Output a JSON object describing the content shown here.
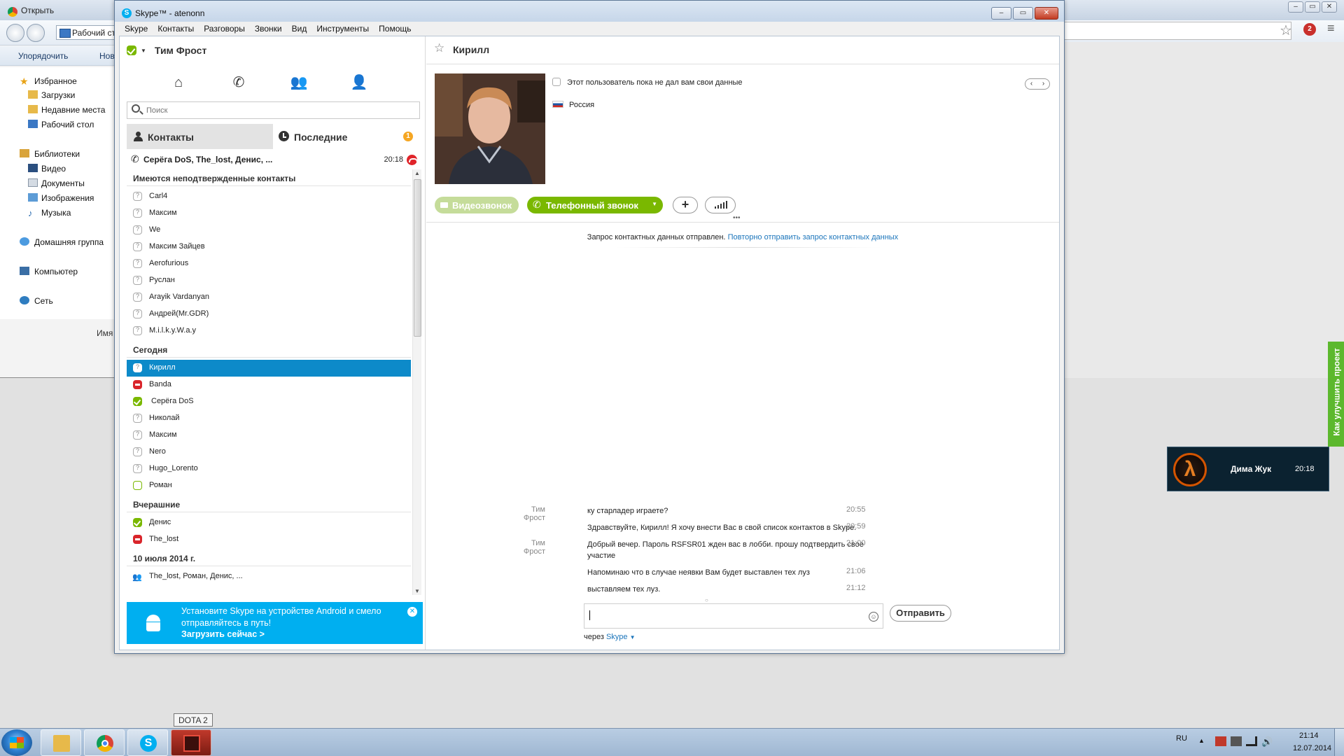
{
  "bg_window": {
    "title": "Открыть",
    "address": "Рабочий стол",
    "organize": "Упорядочить",
    "new_folder": "Нов",
    "nav": {
      "favorites": "Избранное",
      "downloads": "Загрузки",
      "recent_places": "Недавние места",
      "desktop": "Рабочий стол",
      "libraries": "Библиотеки",
      "video": "Видео",
      "documents": "Документы",
      "images": "Изображения",
      "music": "Музыка",
      "homegroup": "Домашняя группа",
      "computer": "Компьютер",
      "network": "Сеть"
    },
    "name_column": "Имя",
    "abp_badge": "2"
  },
  "skype": {
    "title": "Skype™ - atenonn",
    "menu": [
      "Skype",
      "Контакты",
      "Разговоры",
      "Звонки",
      "Вид",
      "Инструменты",
      "Помощь"
    ],
    "me": {
      "name": "Тим Фрост",
      "status": "online"
    },
    "toolbar_icons": [
      "home-icon",
      "phone-icon",
      "group-icon",
      "add-contact-icon"
    ],
    "search": {
      "placeholder": "Поиск",
      "value": ""
    },
    "tabs": {
      "contacts": "Контакты",
      "recent": "Последние",
      "recent_badge": "1"
    },
    "recent_conversation": {
      "names": "Серёга DoS, The_lost, Денис, ...",
      "time": "20:18"
    },
    "sections": {
      "pending": "Имеются неподтвержденные контакты",
      "today": "Сегодня",
      "yesterday": "Вчерашние",
      "date": "10 июля 2014 г."
    },
    "pending_contacts": [
      "Carl4",
      "Максим",
      "We",
      "Максим Зайцев",
      "Aerofurious",
      "Руслан",
      "Arayik Vardanyan",
      "Андрей(Mr.GDR)",
      "M.i.l.k.y.W.a.y"
    ],
    "today_contacts": [
      {
        "name": "Кирилл",
        "status": "pending"
      },
      {
        "name": "Banda",
        "status": "dnd"
      },
      {
        "name": "Серёга DoS",
        "status": "online"
      },
      {
        "name": "Николай",
        "status": "pending"
      },
      {
        "name": "Максим",
        "status": "pending"
      },
      {
        "name": "Nero",
        "status": "pending"
      },
      {
        "name": "Hugo_Lorento",
        "status": "pending"
      },
      {
        "name": "Роман",
        "status": "offline"
      }
    ],
    "yesterday_contacts": [
      {
        "name": "Денис",
        "status": "online"
      },
      {
        "name": "The_lost",
        "status": "dnd"
      }
    ],
    "date_group": "The_lost, Роман, Денис, ...",
    "promo": {
      "text": "Установите Skype на устройстве Android и смело отправляйтесь в путь!",
      "link": "Загрузить сейчас >"
    },
    "chat": {
      "contact_name": "Кирилл",
      "info_text": "Этот пользователь пока не дал вам свои данные",
      "country": "Россия",
      "video_button": "Видеозвонок",
      "call_button": "Телефонный звонок",
      "request_text": "Запрос контактных данных отправлен.",
      "request_link": "Повторно отправить запрос контактных данных",
      "messages": [
        {
          "sender": "Тим Фрост",
          "text": "ку старладер играете?",
          "time": "20:55"
        },
        {
          "sender": "",
          "text": "Здравствуйте, Кирилл! Я хочу внести Вас в свой список контактов в Skype.",
          "time": "20:59"
        },
        {
          "sender": "Тим Фрост",
          "text": "Добрый вечер. Пароль RSFSR01 жден вас в лобби. прошу подтвердить свое участие",
          "time": "21:00"
        },
        {
          "sender": "",
          "text": "Напоминаю что в случае неявки Вам будет выставлен тех луз",
          "time": "21:06"
        },
        {
          "sender": "",
          "text": "выставляем тех луз.",
          "time": "21:12"
        }
      ],
      "compose_value": "",
      "send_button": "Отправить",
      "via_label": "через",
      "via_value": "Skype"
    }
  },
  "feedback_tab": "Как улучшить проект",
  "notification": {
    "name": "Дима Жук",
    "time": "20:18",
    "game_icon": "λ"
  },
  "taskbar": {
    "tooltip": "DOTA 2",
    "language": "RU",
    "time": "21:14",
    "date": "12.07.2014"
  }
}
